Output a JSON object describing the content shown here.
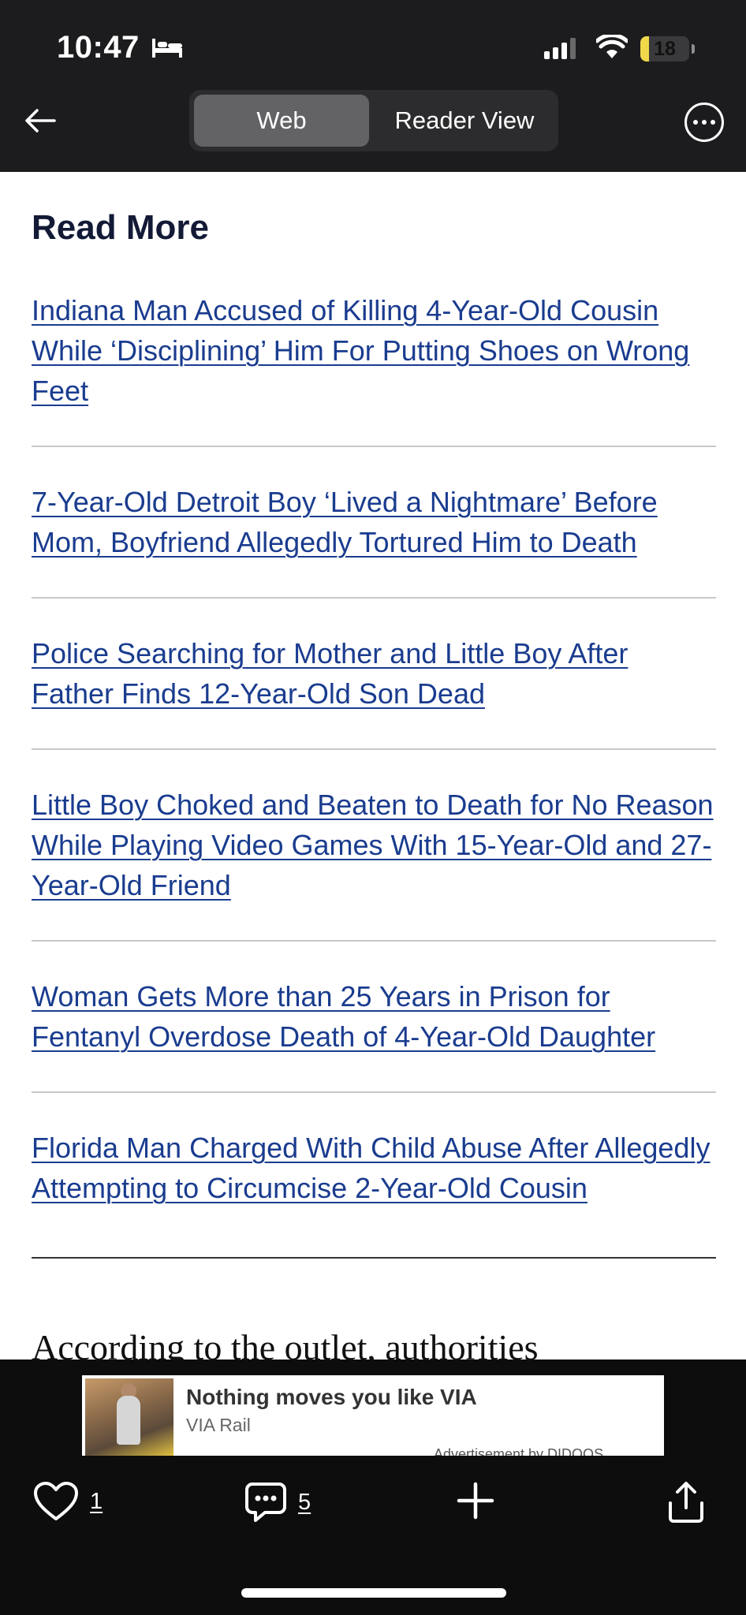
{
  "status": {
    "time": "10:47",
    "battery": "18",
    "battery_level": 0.18
  },
  "nav": {
    "web_label": "Web",
    "reader_label": "Reader View"
  },
  "content": {
    "heading": "Read More",
    "links": [
      "Indiana Man Accused of Killing 4-Year-Old Cousin While ‘Disciplining’ Him For Putting Shoes on Wrong Feet",
      "7-Year-Old Detroit Boy ‘Lived a Nightmare’ Before Mom, Boyfriend Allegedly Tortured Him to Death",
      "Police Searching for Mother and Little Boy After Father Finds 12-Year-Old Son Dead",
      "Little Boy Choked and Beaten to Death for No Reason While Playing Video Games With 15-Year-Old and 27-Year-Old Friend",
      "Woman Gets More than 25 Years in Prison for Fentanyl Overdose Death of 4-Year-Old Daughter",
      "Florida Man Charged With Child Abuse After Allegedly Attempting to Circumcise 2-Year-Old Cousin"
    ],
    "partial_paragraph": "According to the outlet, authorities"
  },
  "ad": {
    "title": "Nothing moves you like VIA",
    "advertiser": "VIA Rail",
    "fine_print": "Advertisement by DIDOOS"
  },
  "toolbar": {
    "likes": "1",
    "comments": "5"
  },
  "colors": {
    "link": "#1a3c8f",
    "bar_bg": "#1c1c1e",
    "battery": "#f0d84a"
  }
}
